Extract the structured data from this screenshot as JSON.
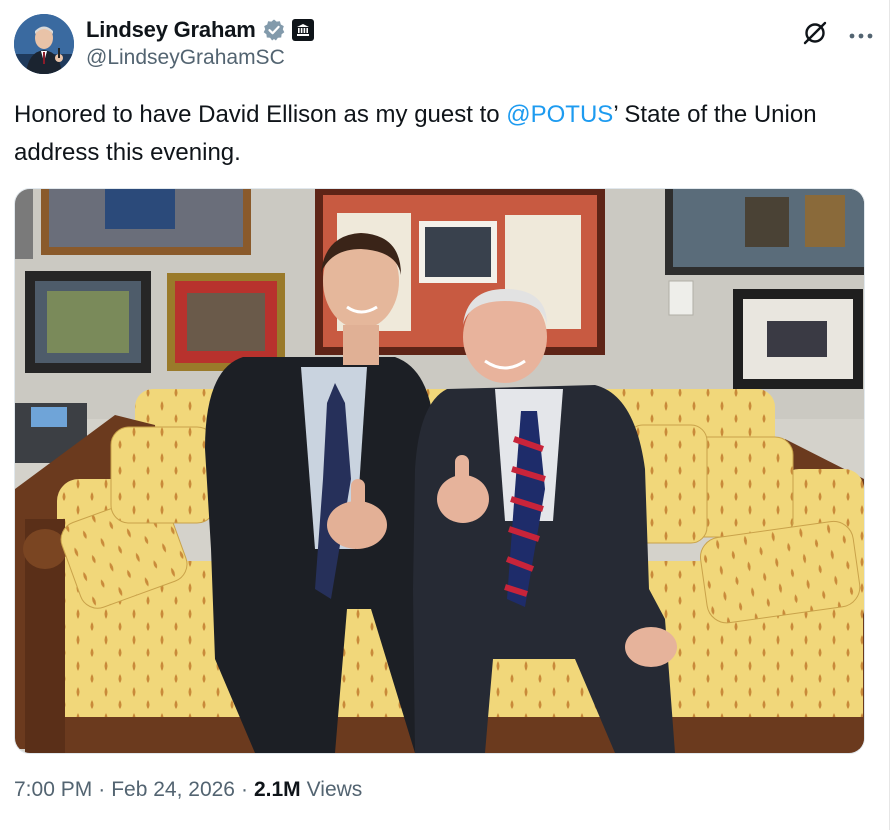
{
  "author": {
    "display_name": "Lindsey Graham",
    "handle": "@LindseyGrahamSC",
    "verified_icon": "verified-badge-icon",
    "affiliation_icon": "government-badge-icon",
    "colors": {
      "verified": "#829aab",
      "mention": "#1d9bf0"
    }
  },
  "actions": {
    "grok_icon": "grok-icon",
    "more_icon": "more-icon"
  },
  "tweet": {
    "text_before": "Honored to have David Ellison as my guest to ",
    "mention": "@POTUS",
    "text_after": "’ State of the Union address this evening."
  },
  "media": {
    "type": "photo",
    "icon": "photo"
  },
  "meta": {
    "time": "7:00 PM",
    "separator_1": "·",
    "date": "Feb 24, 2026",
    "separator_2": "·",
    "views_count": "2.1M",
    "views_label": "Views"
  }
}
